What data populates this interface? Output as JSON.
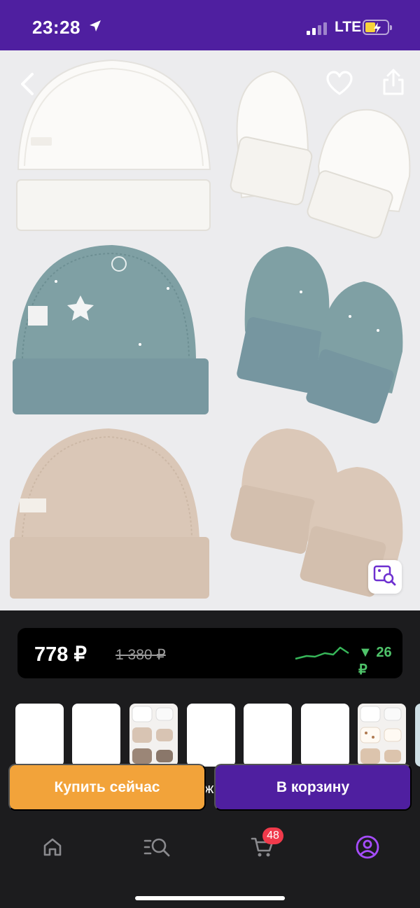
{
  "status_bar": {
    "time": "23:28",
    "network": "LTE"
  },
  "gallery": {
    "back_icon": "chevron-left-icon",
    "favorite_icon": "heart-icon",
    "share_icon": "share-icon",
    "search_by_image_icon": "image-search-icon",
    "product_colors": {
      "white": "#f7f6f3",
      "teal": "#7e9fa3",
      "beige": "#d9c6b6"
    }
  },
  "price": {
    "current": "778 ₽",
    "old": "1 380 ₽",
    "change": "▼ 26 ₽",
    "change_color": "#4fc36a"
  },
  "actions": {
    "buy_now_label": "Купить сейчас",
    "overlap_char": "ж",
    "add_to_cart_label": "В корзину",
    "buy_color": "#f2a33a",
    "cart_color": "#4f1fa0"
  },
  "tabbar": {
    "items": [
      {
        "icon": "home-icon"
      },
      {
        "icon": "catalog-search-icon"
      },
      {
        "icon": "cart-icon",
        "badge": "48"
      },
      {
        "icon": "profile-icon",
        "active": true
      }
    ],
    "active_color": "#a64dff"
  }
}
